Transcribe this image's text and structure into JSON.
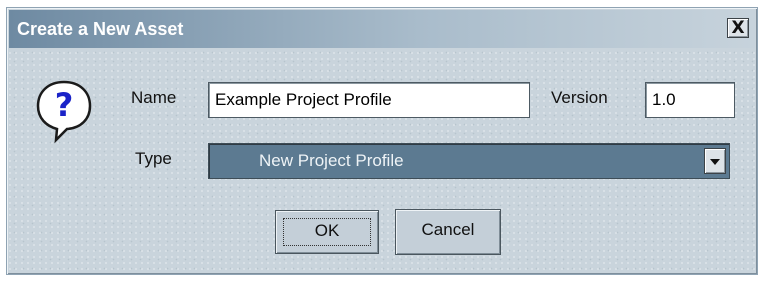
{
  "dialog": {
    "title": "Create a New Asset",
    "close_label": "X",
    "icon": "question-icon",
    "name_label": "Name",
    "name_value": "Example Project Profile",
    "version_label": "Version",
    "version_value": "1.0",
    "type_label": "Type",
    "type_value": "New Project Profile",
    "ok_label": "OK",
    "cancel_label": "Cancel"
  },
  "colors": {
    "title_gradient_start": "#6e8aa2",
    "dialog_background": "#c9d4dc",
    "select_background": "#5c7a91",
    "icon_question_mark": "#1a23c8"
  }
}
